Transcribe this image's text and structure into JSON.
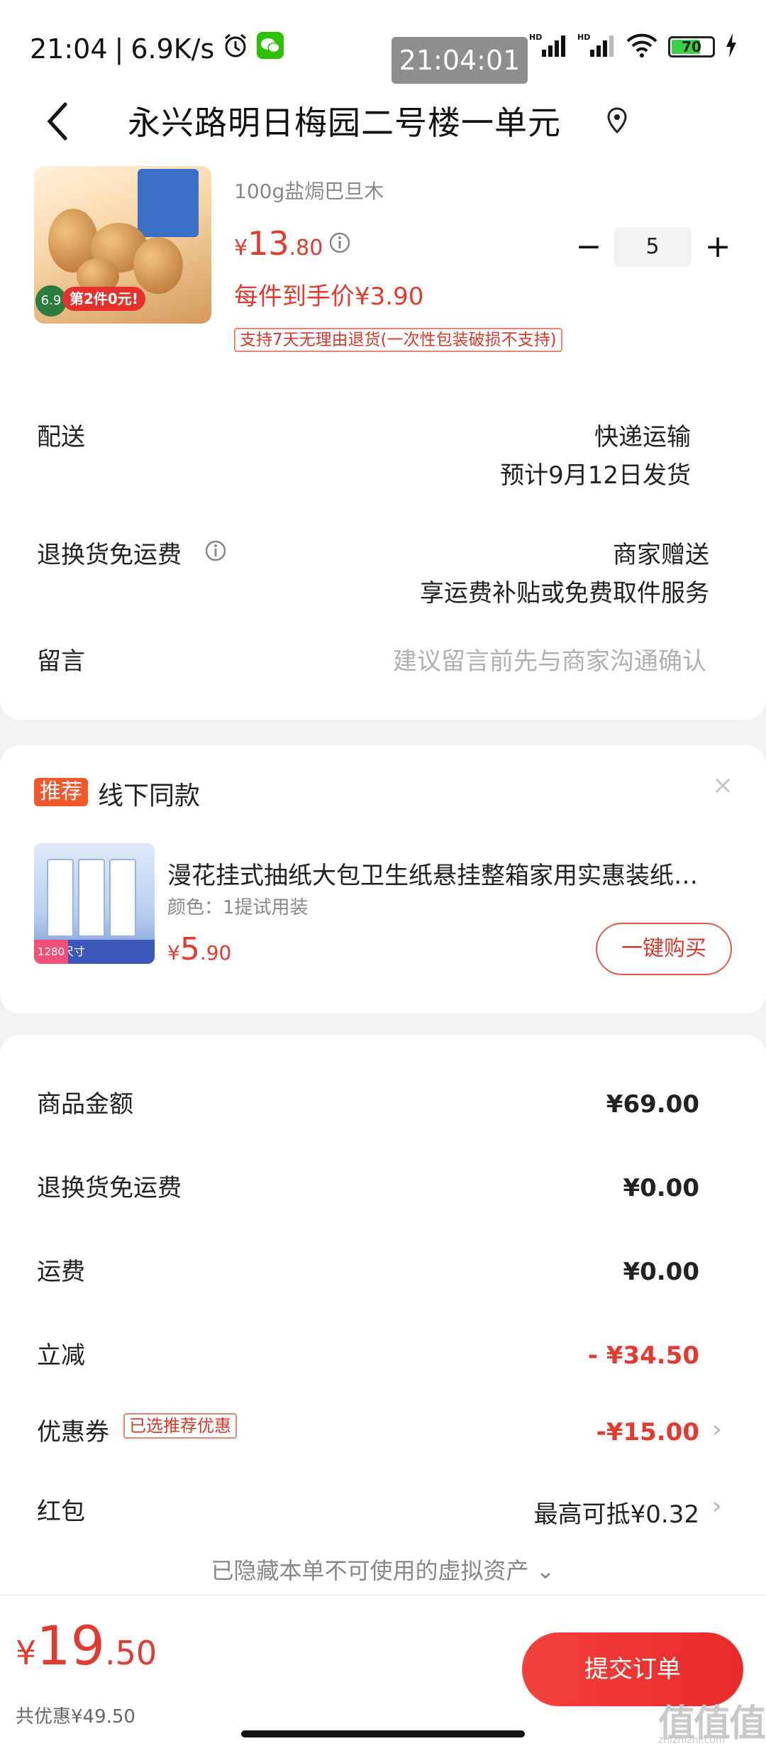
{
  "status_bar": {
    "time": "21:04",
    "speed": "6.9K/s",
    "overlay_time": "21:04:01",
    "battery": "70"
  },
  "header": {
    "title": "永兴路明日梅园二号楼一单元"
  },
  "product": {
    "spec": "100g盐焗巴旦木",
    "price_currency": "¥",
    "price_int": "13",
    "price_dec": ".80",
    "quantity": "5",
    "unit_price": "每件到手价¥3.90",
    "return_tag": "支持7天无理由退货(一次性包装破损不支持)",
    "image_badge": "第2件0元!",
    "image_price": "6.9"
  },
  "delivery": {
    "label": "配送",
    "method": "快递运输",
    "eta": "预计9月12日发货"
  },
  "return_fee": {
    "label": "退换货免运费",
    "value": "商家赠送",
    "desc": "享运费补贴或免费取件服务"
  },
  "message": {
    "label": "留言",
    "placeholder": "建议留言前先与商家沟通确认"
  },
  "recommend": {
    "badge": "推荐",
    "title": "线下同款",
    "close": "×",
    "name": "漫花挂式抽纸大包卫生纸悬挂整箱家用实惠装纸…",
    "spec": "颜色：1提试用装",
    "price_currency": "¥",
    "price_int": "5",
    "price_dec": ".90",
    "buy_label": "一键购买",
    "image_tag": "加大尺寸156*175mm",
    "image_count": "1280"
  },
  "summary": {
    "goods_label": "商品金额",
    "goods_value": "¥69.00",
    "return_label": "退换货免运费",
    "return_value": "¥0.00",
    "shipping_label": "运费",
    "shipping_value": "¥0.00",
    "discount_label": "立减",
    "discount_value": "- ¥34.50",
    "coupon_label": "优惠券",
    "coupon_tag": "已选推荐优惠",
    "coupon_value": "-¥15.00",
    "redpacket_label": "红包",
    "redpacket_value": "最高可抵¥0.32",
    "hidden_note": "已隐藏本单不可使用的虚拟资产 ⌄"
  },
  "bottom": {
    "total_currency": "¥",
    "total_int": "19",
    "total_dec": ".50",
    "total_discount": "共优惠¥49.50",
    "submit_label": "提交订单",
    "watermark": "值值值",
    "watermark_sub": "zhizhizhi.com"
  },
  "colors": {
    "accent_red": "#e23a2f",
    "badge_orange": "#f2582a",
    "battery_green": "#3cd048"
  },
  "icons": [
    "back-arrow-icon",
    "location-pin-icon",
    "info-icon",
    "alarm-icon",
    "wechat-icon",
    "signal-icon",
    "wifi-icon",
    "battery-icon",
    "charging-icon",
    "chevron-right-icon",
    "close-icon"
  ]
}
